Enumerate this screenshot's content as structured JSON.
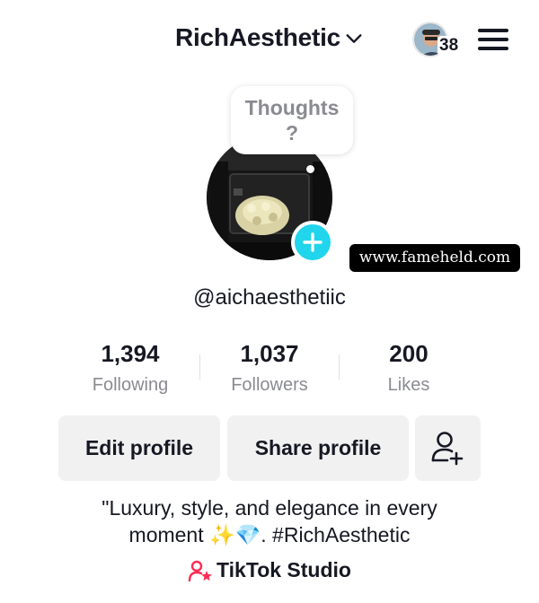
{
  "header": {
    "username": "RichAesthetic",
    "notification_count": "38"
  },
  "thought_bubble": {
    "line1": "Thoughts",
    "line2": "?"
  },
  "watermark": "www.fameheld.com",
  "profile": {
    "handle": "@aichaesthetiic"
  },
  "stats": [
    {
      "value": "1,394",
      "label": "Following"
    },
    {
      "value": "1,037",
      "label": "Followers"
    },
    {
      "value": "200",
      "label": "Likes"
    }
  ],
  "actions": {
    "edit_label": "Edit profile",
    "share_label": "Share profile"
  },
  "bio": {
    "line1": "\"Luxury, style, and elegance in every",
    "line2": "moment ✨💎. #RichAesthetic"
  },
  "studio": {
    "label": "TikTok Studio"
  },
  "colors": {
    "accent": "#20d5ec",
    "studio_pink": "#fe2c55",
    "secondary_text": "#8a8b91",
    "button_bg": "#f1f1f2"
  },
  "icons": [
    "chevron-down-icon",
    "menu-icon",
    "add-icon",
    "add-friend-icon",
    "studio-icon"
  ]
}
